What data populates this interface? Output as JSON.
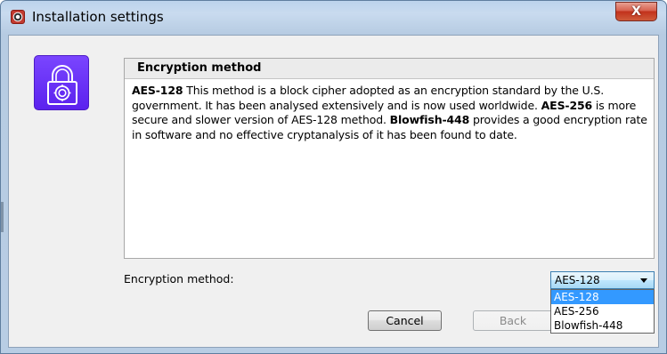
{
  "window": {
    "title": "Installation settings",
    "close_glyph": "X",
    "accent_color": "#6a33f7"
  },
  "icons": {
    "app": "app-badge-icon",
    "lock": "padlock-icon",
    "close": "close-icon",
    "dropdown": "chevron-down-icon"
  },
  "info": {
    "header": "Encryption method",
    "paragraph": [
      {
        "bold": true,
        "text": "AES-128"
      },
      {
        "bold": false,
        "text": " This method is a block cipher adopted as an encryption standard by the U.S. government. It has been analysed extensively and is now used worldwide. "
      },
      {
        "bold": true,
        "text": "AES-256"
      },
      {
        "bold": false,
        "text": " is more secure and slower version of AES-128 method. "
      },
      {
        "bold": true,
        "text": "Blowfish-448"
      },
      {
        "bold": false,
        "text": " provides a good encryption rate in software and no effective cryptanalysis of it has been found to date."
      }
    ]
  },
  "form": {
    "method_label": "Encryption method:",
    "selected_value": "AES-128",
    "options": [
      {
        "label": "AES-128",
        "highlighted": true
      },
      {
        "label": "AES-256",
        "highlighted": false
      },
      {
        "label": "Blowfish-448",
        "highlighted": false
      }
    ]
  },
  "buttons": {
    "cancel": "Cancel",
    "back": "Back"
  }
}
